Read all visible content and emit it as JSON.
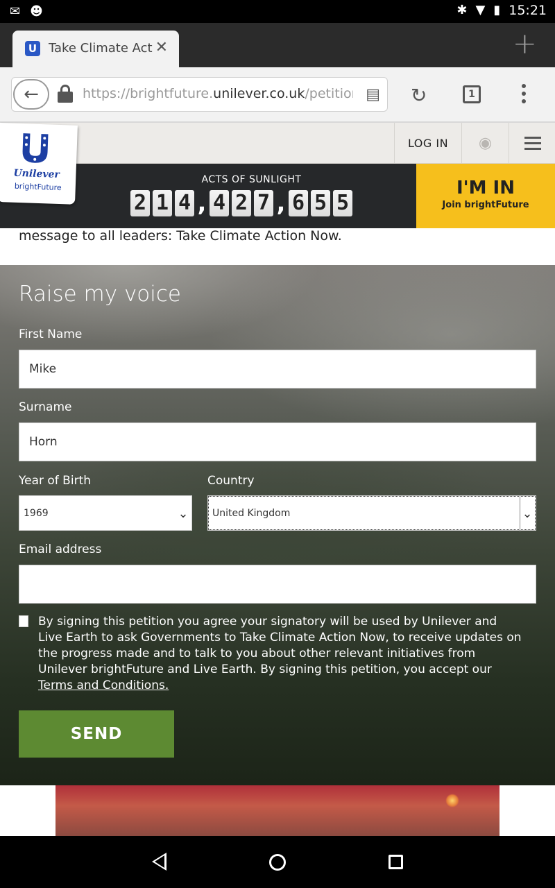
{
  "status_bar": {
    "time": "15:21",
    "left_icons": [
      "gmail-icon",
      "android-icon"
    ],
    "right_icons": [
      "bluetooth-icon",
      "wifi-icon",
      "battery-icon"
    ]
  },
  "browser": {
    "tab_title": "Take Climate Act",
    "url_prefix": "https://brightfuture.",
    "url_domain": "unilever.co.uk",
    "url_suffix": "/petition",
    "tab_count": "1"
  },
  "site_header": {
    "login_label": "LOG IN"
  },
  "logo": {
    "brand": "Unilever",
    "sub": "brightFuture"
  },
  "counter": {
    "label": "ACTS OF SUNLIGHT",
    "digits": [
      "2",
      "1",
      "4",
      ",",
      "4",
      "2",
      "7",
      ",",
      "6",
      "5",
      "5"
    ],
    "value": 214427655
  },
  "im_in": {
    "title": "I'M IN",
    "subtitle": "Join brightFuture"
  },
  "intro_text": "message to all leaders: Take Climate Action Now.",
  "form": {
    "title": "Raise my voice",
    "first_name_label": "First Name",
    "first_name_value": "Mike",
    "surname_label": "Surname",
    "surname_value": "Horn",
    "year_label": "Year of Birth",
    "year_value": "1969",
    "country_label": "Country",
    "country_value": "United Kingdom",
    "email_label": "Email address",
    "email_value": "",
    "legal_text": "By signing this petition you agree your signatory will be used by Unilever and Live Earth to ask Governments to Take Climate Action Now, to receive updates on the progress made and to talk to you about other relevant initiatives from Unilever brightFuture and Live Earth. By signing this petition, you accept our",
    "terms_link": "Terms and Conditions.",
    "send_label": "SEND"
  },
  "colors": {
    "send_green": "#5d8a32",
    "im_in_yellow": "#f6bf1c",
    "banner_dark": "#26282a"
  }
}
